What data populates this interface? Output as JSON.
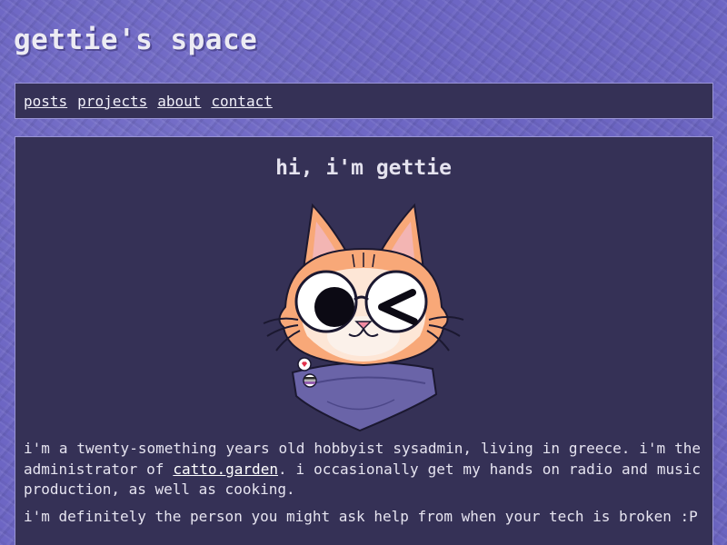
{
  "site": {
    "title": "gettie's space"
  },
  "nav": {
    "items": [
      "posts",
      "projects",
      "about",
      "contact"
    ]
  },
  "main": {
    "heading": "hi, i'm gettie",
    "avatar": {
      "icon": "cat-avatar-winking-icon"
    },
    "paragraph1": {
      "before": "i'm a twenty-something years old hobbyist sysadmin, living in greece. i'm the administrator of ",
      "link": "catto.garden",
      "after": ". i occasionally get my hands on radio and music production, as well as cooking."
    },
    "paragraph2": "i'm definitely the person you might ask help from when your tech is broken :P"
  },
  "colors": {
    "background": "#6d66c4",
    "panel": "#353156",
    "panel_border": "#9a95d6",
    "text": "#e6e4f0"
  }
}
